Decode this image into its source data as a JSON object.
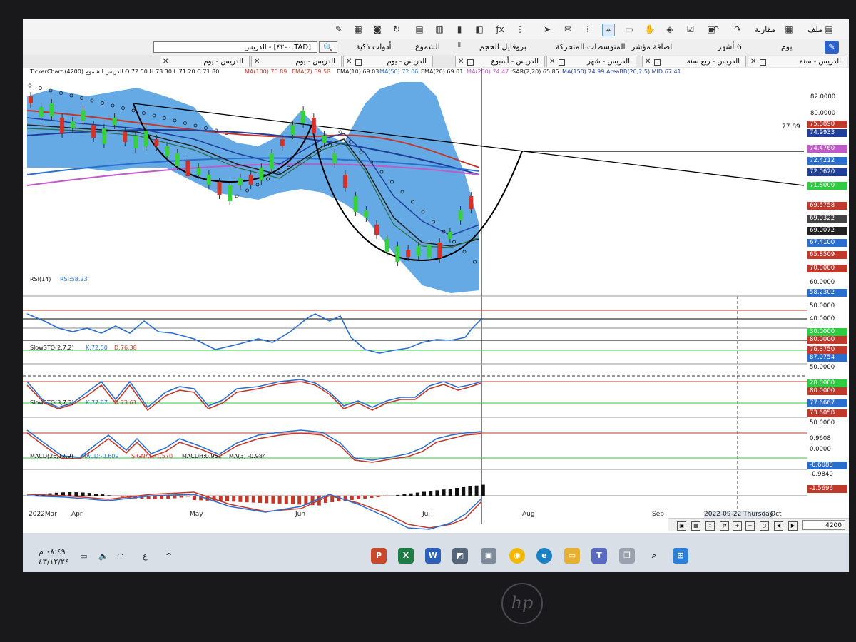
{
  "toolbar1": {
    "items": [
      "ملف",
      "مقارنة"
    ]
  },
  "toolbar2": {
    "symbol": "[TAD.٤٢٠٠] - الدريس",
    "smart_tools": "أدوات ذكية",
    "candles": "الشموع",
    "volume_profile": "بروفايل الحجم",
    "moving_averages": "المتوسطات المتحركة",
    "add_indicator": "اضافة مؤشر",
    "period_6m": "6 أشهر",
    "period_day": "يوم"
  },
  "tabs": [
    {
      "label": "الدريس - يوم"
    },
    {
      "label": "الدريس - يوم"
    },
    {
      "label": "الدريس - يوم"
    },
    {
      "label": "الدريس - أسبوع"
    },
    {
      "label": "الدريس - شهر"
    },
    {
      "label": "الدريس - ربع سنة"
    },
    {
      "label": "الدريس - سنة"
    }
  ],
  "main_panel": {
    "header": "TickerChart الدريس الشموع (4200) O:72.50  H:73.30  L:71.20  C:71.80",
    "ma100": "MA(100) 75.89",
    "ema7": "EMA(7) 69.58",
    "ema10": "EMA(10) 69.03",
    "ma50": "MA(50) 72.06",
    "ema20": "EMA(20) 69.01",
    "ma200": "MA(200) 74.47",
    "sar": "SAR(2,20) 65.85",
    "ma150": "MA(150) 74.99",
    "areabb": "AreaBB(20,2.5) MID:67.41",
    "trend_label": "77.89",
    "axis_ticks": [
      "82.0000",
      "80.0000"
    ],
    "price_tags": [
      {
        "text": "75.8890",
        "color": "#c0392b"
      },
      {
        "text": "74.9933",
        "color": "#1f3f9a"
      },
      {
        "text": "74.4760",
        "color": "#c05ac9"
      },
      {
        "text": "72.4212",
        "color": "#2a6fcf"
      },
      {
        "text": "72.0620",
        "color": "#1f3f9a"
      },
      {
        "text": "71.8000",
        "color": "#2ecc40"
      },
      {
        "text": "69.5758",
        "color": "#c0392b"
      },
      {
        "text": "69.0322",
        "color": "#444444"
      },
      {
        "text": "69.0072",
        "color": "#222222"
      },
      {
        "text": "67.4100",
        "color": "#2a6fcf"
      },
      {
        "text": "65.8509",
        "color": "#c0392b"
      },
      {
        "text": "70.0000",
        "color": "#c0392b"
      }
    ]
  },
  "rsi_panel": {
    "title": "RSI(14)",
    "value": "RSI:58.23",
    "axis": [
      {
        "text": "60.0000",
        "color": "#222"
      },
      {
        "text": "58.2302",
        "color": "#2a6fcf"
      },
      {
        "text": "50.0000",
        "color": "#222"
      },
      {
        "text": "40.0000",
        "color": "#222"
      },
      {
        "text": "30.0000",
        "color": "#2ecc40"
      },
      {
        "text": "80.0000",
        "color": "#c0392b"
      }
    ]
  },
  "sto1_panel": {
    "title": "SlowSTO(2,7,2)",
    "k": "K:72.50",
    "d": "D:76.38",
    "axis": [
      {
        "text": "76.3750",
        "color": "#c0392b"
      },
      {
        "text": "87.0754",
        "color": "#2a6fcf"
      },
      {
        "text": "50.0000",
        "color": "#ffffff"
      },
      {
        "text": "20.0000",
        "color": "#2ecc40"
      },
      {
        "text": "80.0000",
        "color": "#c0392b"
      }
    ]
  },
  "sto2_panel": {
    "title": "SlowSTO(3,7,3)",
    "k": "K:77.67",
    "d": "D:73.61",
    "axis": [
      {
        "text": "77.6667",
        "color": "#2a6fcf"
      },
      {
        "text": "73.6058",
        "color": "#c0392b"
      },
      {
        "text": "50.0000",
        "color": "#ffffff"
      },
      {
        "text": "0.9608",
        "color": "#222"
      },
      {
        "text": "0.0000",
        "color": "#222"
      }
    ]
  },
  "macd_panel": {
    "title": "MACD(26,12,9)",
    "macd": "MACD:-0.609",
    "signal": "SIGNAL:-1.570",
    "macdh": "MACDH:0.961",
    "ma3": "MA(3) -0.984",
    "axis": [
      {
        "text": "-0.6088",
        "color": "#2a6fcf"
      },
      {
        "text": "-0.9840",
        "color": "#222"
      },
      {
        "text": "-1.5696",
        "color": "#c0392b"
      }
    ]
  },
  "x_axis": [
    "2022Mar",
    "Apr",
    "May",
    "Jun",
    "Jul",
    "Aug",
    "Sep",
    "Oct"
  ],
  "crosshair_date": "2022-09-22 Thursday",
  "bottom_bar": {
    "candles_count": "4200"
  },
  "taskbar": {
    "time": "٠٨:٤٩ م",
    "date": "٤٣/١٢/٢٤",
    "lang": "ع"
  },
  "laptop_brand": "hp"
}
